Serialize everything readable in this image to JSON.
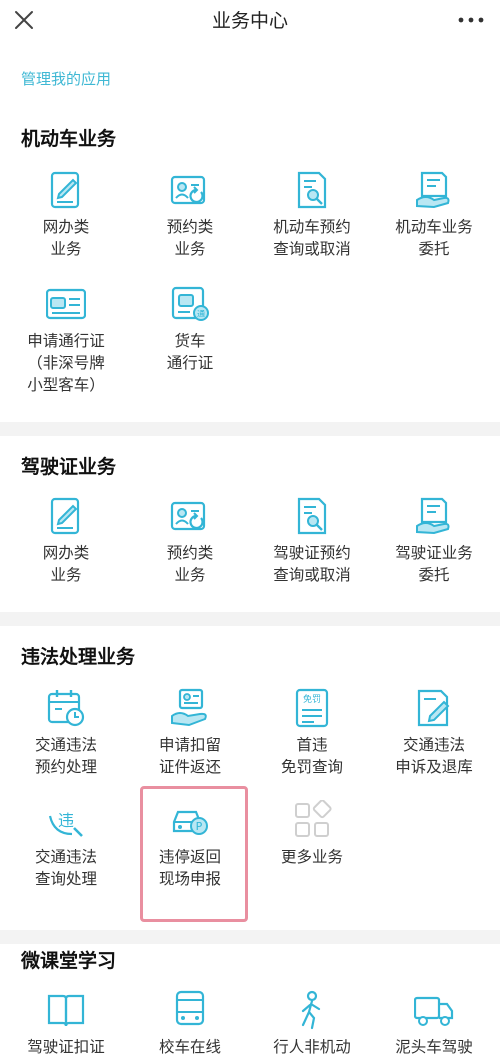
{
  "header": {
    "title": "业务中心",
    "close_icon": "close-icon",
    "more_icon": "more-dots-icon"
  },
  "manage_link": "管理我的应用",
  "colors": {
    "accent": "#33b5d6",
    "link": "#3fb8d4",
    "highlight": "#e98fa0",
    "disabled": "#cfcfcf"
  },
  "sections": [
    {
      "title": "机动车业务",
      "items": [
        {
          "label": "网办类\n业务",
          "icon": "tablet-edit-icon"
        },
        {
          "label": "预约类\n业务",
          "icon": "id-card-refresh-icon"
        },
        {
          "label": "机动车预约\n查询或取消",
          "icon": "document-search-icon"
        },
        {
          "label": "机动车业务\n委托",
          "icon": "hand-document-icon"
        },
        {
          "label": "申请通行证\n（非深号牌\n小型客车）",
          "icon": "car-pass-card-icon"
        },
        {
          "label": "货车\n通行证",
          "icon": "truck-pass-icon"
        }
      ]
    },
    {
      "title": "驾驶证业务",
      "items": [
        {
          "label": "网办类\n业务",
          "icon": "tablet-edit-icon"
        },
        {
          "label": "预约类\n业务",
          "icon": "id-card-refresh-icon"
        },
        {
          "label": "驾驶证预约\n查询或取消",
          "icon": "document-search-icon"
        },
        {
          "label": "驾驶证业务\n委托",
          "icon": "hand-document-icon"
        }
      ]
    },
    {
      "title": "违法处理业务",
      "items": [
        {
          "label": "交通违法\n预约处理",
          "icon": "calendar-clock-icon"
        },
        {
          "label": "申请扣留\n证件返还",
          "icon": "hand-card-return-icon"
        },
        {
          "label": "首违\n免罚查询",
          "icon": "free-penalty-doc-icon",
          "badge": "免罚"
        },
        {
          "label": "交通违法\n申诉及退库",
          "icon": "document-pen-icon"
        },
        {
          "label": "交通违法\n查询处理",
          "icon": "violation-search-icon",
          "badge": "违"
        },
        {
          "label": "违停返回\n现场申报",
          "icon": "car-parking-report-icon",
          "badge": "P"
        },
        {
          "label": "更多业务",
          "icon": "more-apps-icon"
        }
      ]
    },
    {
      "title": "微课堂学习",
      "items": [
        {
          "label": "驾驶证扣证",
          "icon": "book-icon"
        },
        {
          "label": "校车在线",
          "icon": "bus-icon"
        },
        {
          "label": "行人非机动",
          "icon": "pedestrian-icon"
        },
        {
          "label": "泥头车驾驶",
          "icon": "dump-truck-icon"
        }
      ]
    }
  ]
}
